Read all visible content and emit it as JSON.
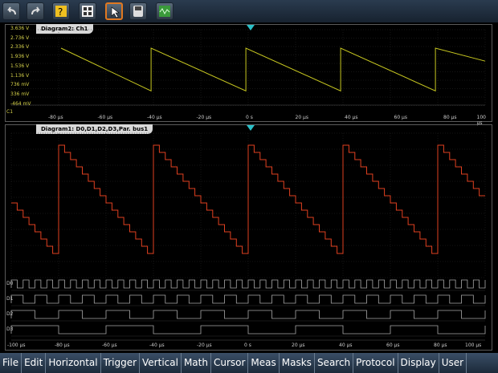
{
  "toolbar": {
    "buttons": [
      {
        "name": "undo-button",
        "icon": "undo-arrow-icon"
      },
      {
        "name": "redo-button",
        "icon": "redo-arrow-icon"
      },
      {
        "name": "help-button",
        "icon": "help-question-icon"
      },
      {
        "name": "film-button",
        "icon": "film-strip-icon"
      },
      {
        "name": "select-pointer-button",
        "icon": "pointer-icon",
        "selected": true
      },
      {
        "name": "storage-button",
        "icon": "disk-icon"
      },
      {
        "name": "signal-screen-button",
        "icon": "waveform-screen-icon"
      }
    ]
  },
  "diagram2": {
    "title": "Diagram2: Ch1",
    "y_ticks": [
      "3.636 V",
      "2.736 V",
      "2.336 V",
      "1.936 V",
      "1.536 V",
      "1.136 V",
      "736 mV",
      "336 mV",
      "-464 mV"
    ],
    "marker": "C1",
    "x_ticks": [
      "-80 µs",
      "-60 µs",
      "-40 µs",
      "-20 µs",
      "0 s",
      "20 µs",
      "40 µs",
      "60 µs",
      "80 µs",
      "100 µs"
    ],
    "trace_color": "#c8c820"
  },
  "diagram1": {
    "title": "Diagram1: D0,D1,D2,D3,Par. bus1",
    "x_ticks": [
      "-100 µs",
      "-80 µs",
      "-60 µs",
      "-40 µs",
      "-20 µs",
      "0 s",
      "20 µs",
      "40 µs",
      "60 µs",
      "80 µs",
      "100 µs"
    ],
    "digital_labels": [
      "D0",
      "D1",
      "D2",
      "D3"
    ],
    "bus_color": "#e04020",
    "digital_color": "#a8a8a8"
  },
  "menu": [
    "File",
    "Edit",
    "Horizontal",
    "Trigger",
    "Vertical",
    "Math",
    "Cursor",
    "Meas",
    "Masks",
    "Search",
    "Protocol",
    "Display",
    "User"
  ],
  "chart_data": [
    {
      "type": "line",
      "title": "Diagram2: Ch1",
      "xlabel": "",
      "ylabel": "",
      "x_unit": "µs",
      "xlim": [
        -100,
        100
      ],
      "ylim": [
        -0.464,
        3.636
      ],
      "series": [
        {
          "x": [
            -79,
            -41,
            -41,
            -1,
            -1,
            39,
            39,
            79,
            79,
            100
          ],
          "y": [
            2.6,
            0.3,
            2.6,
            0.3,
            2.6,
            0.3,
            2.6,
            0.3,
            2.6,
            1.9
          ]
        }
      ]
    },
    {
      "type": "line",
      "title": "Diagram1: D0,D1,D2,D3,Par. bus1",
      "xlabel": "",
      "ylabel": "",
      "x_unit": "µs",
      "xlim": [
        -100,
        100
      ],
      "period_us": 40
    }
  ]
}
